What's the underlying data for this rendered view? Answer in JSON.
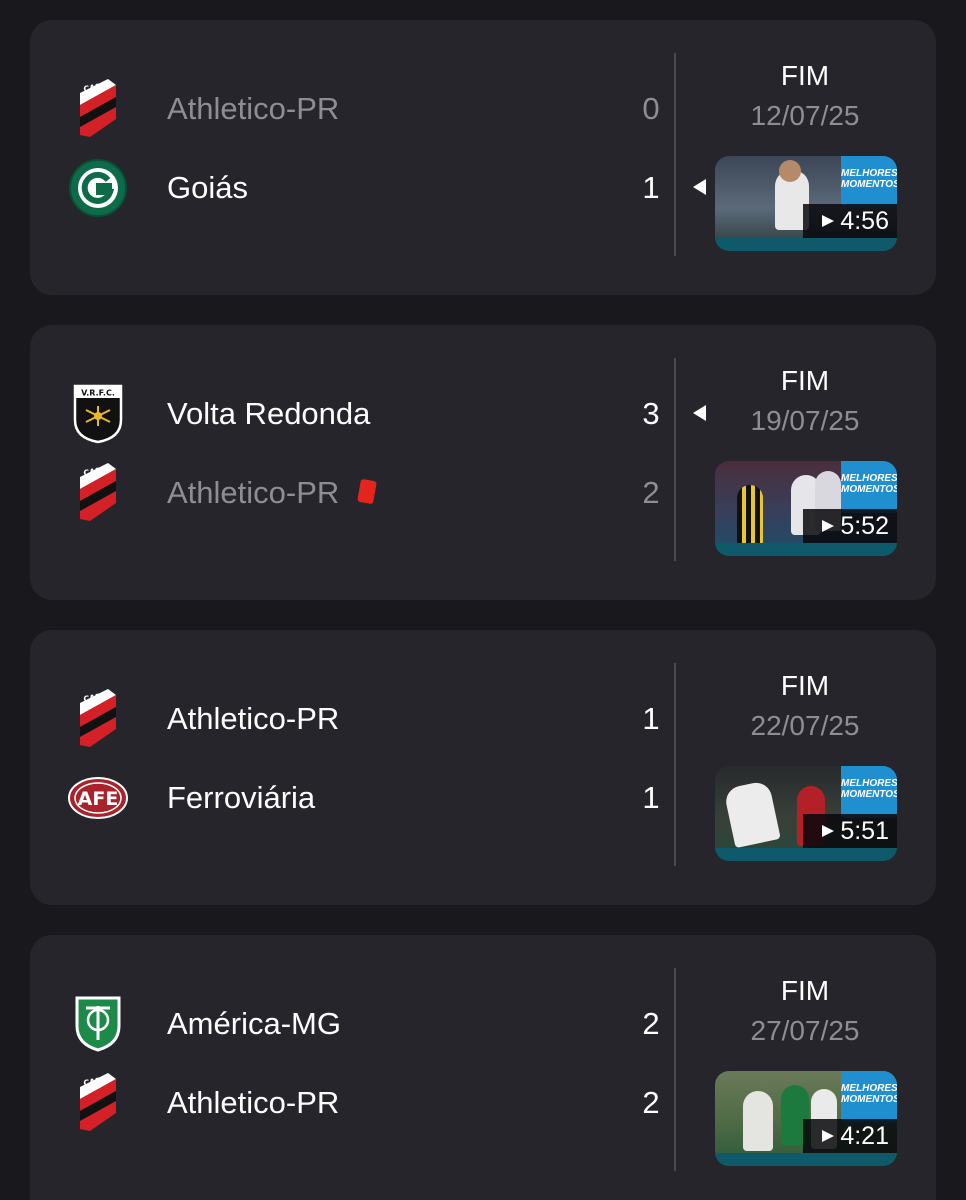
{
  "colors": {
    "page_background": "#19191d",
    "card_background": "#25252b",
    "text_primary": "#ffffff",
    "text_secondary": "#8d8d93",
    "red_card": "#e3251d",
    "video_banner": "#1f8fcf"
  },
  "matches": [
    {
      "status": "FIM",
      "date": "12/07/25",
      "home": {
        "name": "Athletico-PR",
        "score": "0",
        "logo": "athletico-pr-crest",
        "winner": false,
        "red_card": false
      },
      "away": {
        "name": "Goiás",
        "score": "1",
        "logo": "goias-crest",
        "winner": true,
        "red_card": false
      },
      "video": {
        "duration": "4:56",
        "play_icon": "play-icon"
      }
    },
    {
      "status": "FIM",
      "date": "19/07/25",
      "home": {
        "name": "Volta Redonda",
        "score": "3",
        "logo": "volta-redonda-crest",
        "winner": true,
        "red_card": false
      },
      "away": {
        "name": "Athletico-PR",
        "score": "2",
        "logo": "athletico-pr-crest",
        "winner": false,
        "red_card": true
      },
      "video": {
        "duration": "5:52",
        "play_icon": "play-icon"
      }
    },
    {
      "status": "FIM",
      "date": "22/07/25",
      "home": {
        "name": "Athletico-PR",
        "score": "1",
        "logo": "athletico-pr-crest",
        "winner": false,
        "red_card": false
      },
      "away": {
        "name": "Ferroviária",
        "score": "1",
        "logo": "ferroviaria-crest",
        "winner": false,
        "red_card": false
      },
      "video": {
        "duration": "5:51",
        "play_icon": "play-icon"
      }
    },
    {
      "status": "FIM",
      "date": "27/07/25",
      "home": {
        "name": "América-MG",
        "score": "2",
        "logo": "america-mg-crest",
        "winner": false,
        "red_card": false
      },
      "away": {
        "name": "Athletico-PR",
        "score": "2",
        "logo": "athletico-pr-crest",
        "winner": false,
        "red_card": false
      },
      "video": {
        "duration": "4:21",
        "play_icon": "play-icon"
      }
    }
  ]
}
